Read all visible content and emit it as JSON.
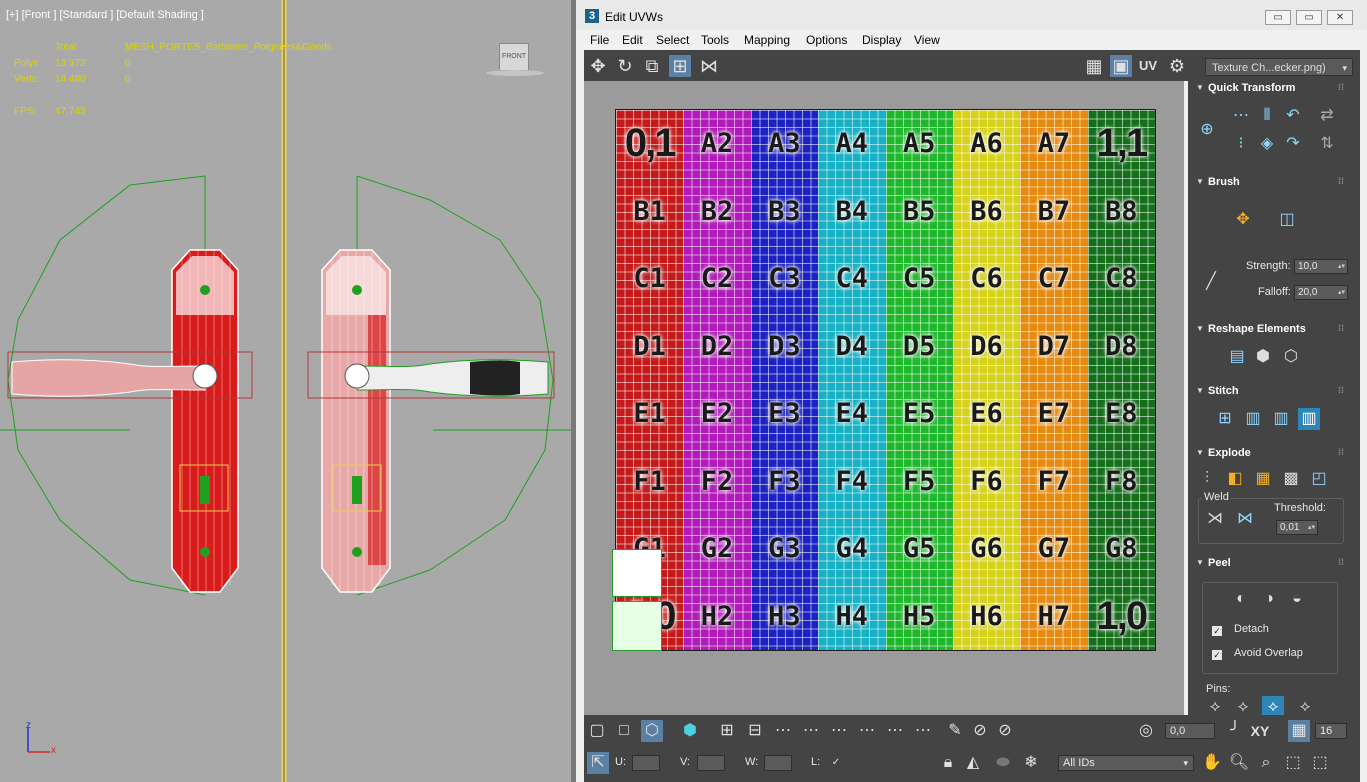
{
  "viewport": {
    "label": "[+] [Front ] [Standard ] [Default Shading ]",
    "stats": {
      "total_label": "Total",
      "object_name": "MESH_PORTES_Battantes_Poignees&Gonds",
      "polys_label": "Polys:",
      "polys_total": "13 372",
      "polys_sel": "0",
      "verts_label": "Verts:",
      "verts_total": "14 480",
      "verts_sel": "0",
      "fps_label": "FPS:",
      "fps_value": "47,743"
    },
    "viewcube_label": "FRONT",
    "axis_z": "z",
    "axis_x": "x"
  },
  "window": {
    "app_icon": "3",
    "title": "Edit UVWs",
    "minimize": "▭",
    "maximize": "▭",
    "close": "✕"
  },
  "menu": [
    "File",
    "Edit",
    "Select",
    "Tools",
    "Mapping",
    "Options",
    "Display",
    "View"
  ],
  "toolbar": {
    "uv_label": "UV",
    "texture_select": "Texture Ch...ecker.png)"
  },
  "checker": {
    "columns": [
      {
        "color": "#c41a1a",
        "cells": [
          "0,1",
          "B1",
          "C1",
          "D1",
          "E1",
          "F1",
          "G1",
          "0,0"
        ]
      },
      {
        "color": "#b01ab8",
        "cells": [
          "A2",
          "B2",
          "C2",
          "D2",
          "E2",
          "F2",
          "G2",
          "H2"
        ]
      },
      {
        "color": "#1c22c0",
        "cells": [
          "A3",
          "B3",
          "C3",
          "D3",
          "E3",
          "F3",
          "G3",
          "H3"
        ]
      },
      {
        "color": "#17b0c4",
        "cells": [
          "A4",
          "B4",
          "C4",
          "D4",
          "E4",
          "F4",
          "G4",
          "H4"
        ]
      },
      {
        "color": "#1fb82c",
        "cells": [
          "A5",
          "B5",
          "C5",
          "D5",
          "E5",
          "F5",
          "G5",
          "H5"
        ]
      },
      {
        "color": "#d6d21a",
        "cells": [
          "A6",
          "B6",
          "C6",
          "D6",
          "E6",
          "F6",
          "G6",
          "H6"
        ]
      },
      {
        "color": "#e68b12",
        "cells": [
          "A7",
          "B7",
          "C7",
          "D7",
          "E7",
          "F7",
          "G7",
          "H7"
        ]
      },
      {
        "color": "#156e1a",
        "cells": [
          "1,1",
          "B8",
          "C8",
          "D8",
          "E8",
          "F8",
          "G8",
          "1,0"
        ]
      }
    ]
  },
  "panel": {
    "quick_transform": "Quick Transform",
    "brush": "Brush",
    "strength_label": "Strength:",
    "strength_value": "10,0",
    "falloff_label": "Falloff:",
    "falloff_value": "20,0",
    "reshape": "Reshape Elements",
    "stitch": "Stitch",
    "explode": "Explode",
    "weld": "Weld",
    "threshold_label": "Threshold:",
    "threshold_value": "0,01",
    "peel": "Peel",
    "detach": "Detach",
    "avoid_overlap": "Avoid Overlap",
    "pins": "Pins:"
  },
  "bottombar": {
    "angle_value": "0,0",
    "xy_label": "XY",
    "grid_value": "16",
    "u_label": "U:",
    "v_label": "V:",
    "w_label": "W:",
    "l_label": "L:",
    "ids_select": "All IDs"
  }
}
